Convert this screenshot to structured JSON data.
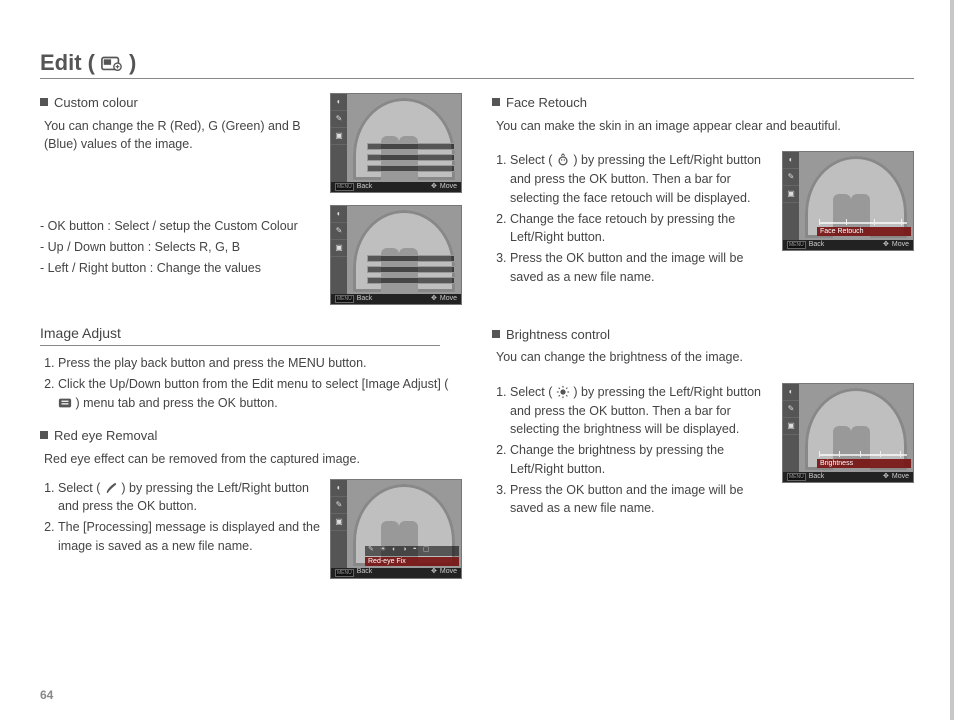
{
  "pageTitle": "Edit (",
  "pageTitleEnd": ")",
  "pageNumber": "64",
  "screenshotBottom": {
    "menu": "MENU",
    "back": "Back",
    "move": "Move"
  },
  "left": {
    "customColour": {
      "title": "Custom colour",
      "desc": "You can change the R (Red), G (Green) and B (Blue) values of the image.",
      "controls": {
        "ok": "- OK button : Select / setup the Custom Colour",
        "updown": "- Up / Down button  : Selects R, G, B",
        "leftright": "- Left / Right button  : Change the values"
      }
    },
    "imageAdjust": {
      "heading": "Image Adjust",
      "step1": "Press the play back button and press the MENU button.",
      "step2a": "Click the Up/Down button from the Edit menu to select [Image Adjust] (",
      "step2b": ") menu tab and press the OK button."
    },
    "redEye": {
      "title": "Red eye Removal",
      "desc": "Red eye effect can be removed from the captured image.",
      "step1a": "Select (",
      "step1b": ") by pressing the Left/Right button and press the OK button.",
      "step2": "The [Processing] message is displayed and the image is saved as a new file name.",
      "label": "Red-eye Fix"
    }
  },
  "right": {
    "faceRetouch": {
      "title": "Face Retouch",
      "desc": "You can make the skin in an image appear clear and beautiful.",
      "step1a": "Select (",
      "step1b": ") by pressing the Left/Right button and press the OK button. Then a bar for selecting the face retouch will be displayed.",
      "step2": "Change the face retouch by pressing the Left/Right button.",
      "step3": "Press the OK button and the image will be saved as a new file name.",
      "label": "Face Retouch"
    },
    "brightness": {
      "title": "Brightness control",
      "desc": "You can change the brightness of the image.",
      "step1a": "Select (",
      "step1b": ") by pressing the Left/Right button and press the OK button. Then a bar for selecting the brightness will be displayed.",
      "step2": "Change the brightness by pressing the Left/Right button.",
      "step3": "Press the OK button and the image will be saved as a new file name.",
      "label": "Brightness"
    }
  }
}
